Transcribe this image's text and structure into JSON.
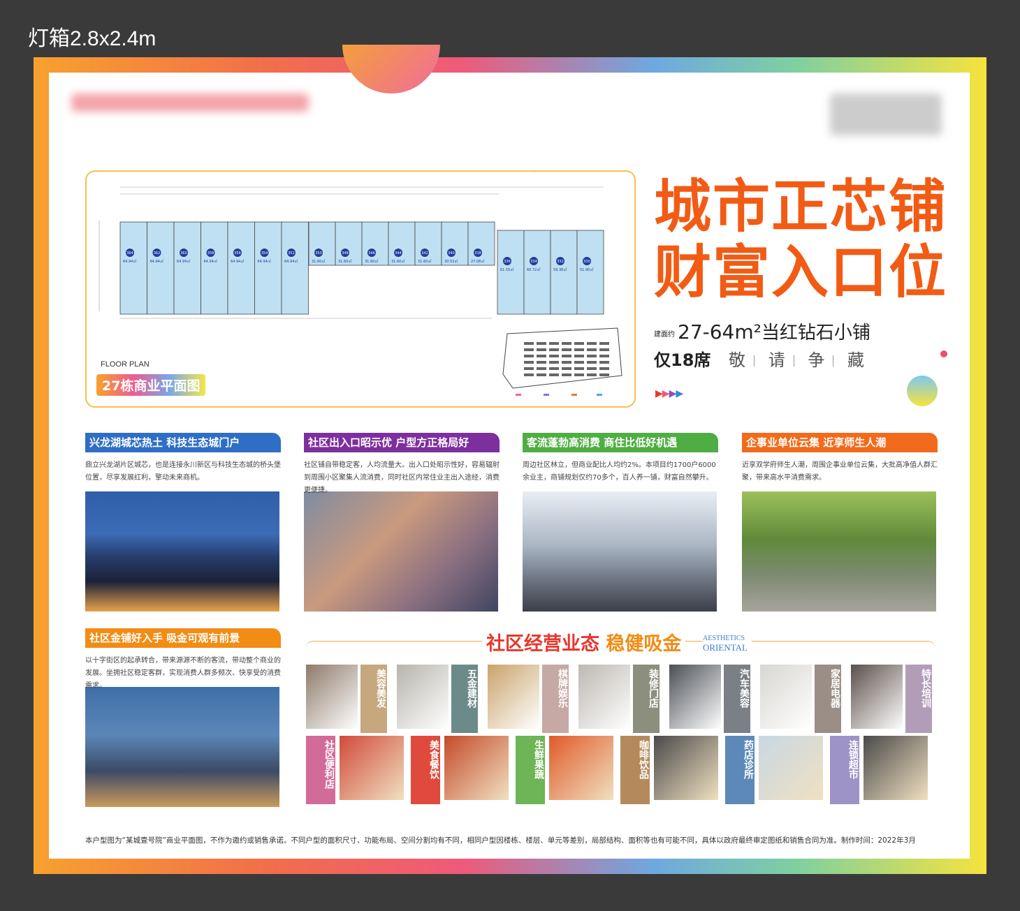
{
  "spec_label": "灯箱2.8x2.4m",
  "plan": {
    "floor_plan_label": "FLOOR PLAN",
    "tag": "27栋商业平面图",
    "units_left": [
      {
        "no": "364",
        "area": "64.94㎡"
      },
      {
        "no": "362",
        "area": "64.94㎡"
      },
      {
        "no": "360",
        "area": "64.94㎡"
      },
      {
        "no": "358",
        "area": "64.94㎡"
      },
      {
        "no": "356",
        "area": "64.94㎡"
      },
      {
        "no": "354",
        "area": "64.94㎡"
      },
      {
        "no": "352",
        "area": "64.94㎡"
      }
    ],
    "units_mid": [
      {
        "no": "350",
        "area": "31.60㎡"
      },
      {
        "no": "348",
        "area": "31.60㎡"
      },
      {
        "no": "346",
        "area": "31.60㎡"
      },
      {
        "no": "344",
        "area": "31.60㎡"
      },
      {
        "no": "342",
        "area": "31.60㎡"
      },
      {
        "no": "340",
        "area": "30.53㎡"
      },
      {
        "no": "338",
        "area": "27.08㎡"
      }
    ],
    "units_right": [
      {
        "no": "336",
        "area": "61.55㎡"
      },
      {
        "no": "334",
        "area": "60.72㎡"
      },
      {
        "no": "332",
        "area": "59.36㎡"
      },
      {
        "no": "330",
        "area": "51.90㎡"
      }
    ]
  },
  "headline": {
    "line1": "城市正芯铺",
    "line2": "财富入口位",
    "area_prefix": "建面约",
    "area": "27-64m²",
    "area_suffix": "当红钻石小铺",
    "seats": "仅18席",
    "words": [
      "敬",
      "请",
      "争",
      "藏"
    ]
  },
  "features": [
    {
      "title": "兴龙湖城芯热土 科技生态城门户",
      "desc": "鼎立兴龙湖片区城芯，也是连接永川新区与科技生态城的桥头堡位置，尽享发展红利，擎动未来商机。",
      "color": "#2f6ec5"
    },
    {
      "title": "社区出入口昭示优 户型方正格局好",
      "desc": "社区铺自带稳定客，人均流量大。出入口处昭示性好，容易辐射到周围小区聚集人流消费，同时社区内常住业主出入途经，消费更便捷。",
      "color": "#7d2f9e"
    },
    {
      "title": "客流蓬勃高消费 商住比低好机遇",
      "desc": "周边社区林立，但商业配比人均约2%。本项目约1700户6000余业主，商铺规划仅约70多个，百人养一铺，财富自然攀升。",
      "color": "#4fae43"
    },
    {
      "title": "企事业单位云集 近享师生人潮",
      "desc": "近享双学府师生人潮，周围企事业单位云集，大批高净值人群汇聚，带来高水平消费需求。",
      "color": "#f26a1b"
    },
    {
      "title": "社区金铺好入手 吸金可观有前景",
      "desc": "以十字街区的起承转合，带来源源不断的客流，带动整个商业的发展。坐拥社区稳定客群，实现消费人群多频次、快享受的消费需求。",
      "color": "#f28c15"
    }
  ],
  "business": {
    "title_a": "社区经营业态",
    "title_b": "稳健吸金",
    "en1": "AESTHETICS",
    "en2": "ORIENTAL",
    "row1": [
      {
        "label": "美容美发",
        "color": "#c7a77e"
      },
      {
        "label": "五金建材",
        "color": "#6d8a8a"
      },
      {
        "label": "棋牌娱乐",
        "color": "#c6a9a4"
      },
      {
        "label": "装修门店",
        "color": "#8d8f7e"
      },
      {
        "label": "汽车美容",
        "color": "#7b7f86"
      },
      {
        "label": "家居电器",
        "color": "#9b8e86"
      },
      {
        "label": "特长培训",
        "color": "#b29db9"
      }
    ],
    "row2": [
      {
        "label": "社区便利店",
        "color": "#d36b99"
      },
      {
        "label": "美食餐饮",
        "color": "#e04a3c"
      },
      {
        "label": "生鲜果蔬",
        "color": "#6db556"
      },
      {
        "label": "咖啡饮品",
        "color": "#b48a5c"
      },
      {
        "label": "药店诊所",
        "color": "#5c89b8"
      },
      {
        "label": "连锁超市",
        "color": "#9e93c6"
      }
    ]
  },
  "footer": "本户型图为“某城壹号院”商业平面图，不作为邀约或销售承诺。不同户型的面积尺寸、功能布局、空间分割均有不同，相同户型因楼栋、楼层、单元等差别，局部结构、面积等也有可能不同，具体以政府最终审定图纸和销售合同为准。制作时间：2022年3月"
}
